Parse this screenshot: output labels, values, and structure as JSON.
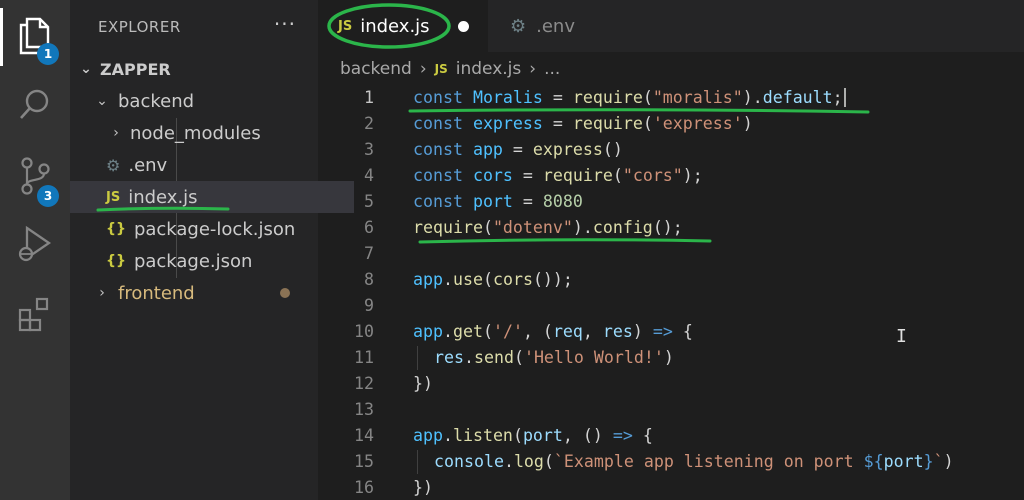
{
  "activity_bar": {
    "explorer_badge": "1",
    "scm_badge": "3",
    "icons": [
      "files-icon",
      "search-icon",
      "source-control-icon",
      "run-debug-icon",
      "extensions-icon"
    ]
  },
  "sidebar": {
    "title": "EXPLORER",
    "more": "···",
    "project": "ZAPPER",
    "items": [
      {
        "label": "backend",
        "type": "folder-open"
      },
      {
        "label": "node_modules",
        "type": "folder-closed"
      },
      {
        "label": ".env",
        "type": "settings-file"
      },
      {
        "label": "index.js",
        "type": "js-file",
        "badge": "JS"
      },
      {
        "label": "package-lock.json",
        "type": "json-file",
        "badge": "{}"
      },
      {
        "label": "package.json",
        "type": "json-file",
        "badge": "{}"
      },
      {
        "label": "frontend",
        "type": "folder-closed"
      }
    ]
  },
  "tabs": [
    {
      "label": "index.js",
      "badge": "JS",
      "active": true,
      "modified": true
    },
    {
      "label": ".env",
      "active": false
    }
  ],
  "breadcrumb": {
    "folder": "backend",
    "file_badge": "JS",
    "file": "index.js",
    "trail": "..."
  },
  "editor": {
    "current_line": 1,
    "lines": [
      {
        "n": "1"
      },
      {
        "n": "2"
      },
      {
        "n": "3"
      },
      {
        "n": "4"
      },
      {
        "n": "5"
      },
      {
        "n": "6"
      },
      {
        "n": "7"
      },
      {
        "n": "8"
      },
      {
        "n": "9"
      },
      {
        "n": "10"
      },
      {
        "n": "11"
      },
      {
        "n": "12"
      },
      {
        "n": "13"
      },
      {
        "n": "14"
      },
      {
        "n": "15"
      },
      {
        "n": "16"
      }
    ],
    "tokens": {
      "const": "const",
      "moralis_var": "Moralis",
      "eq": " = ",
      "require": "require",
      "moralis_str": "\"moralis\"",
      "default_prop": "default",
      "express_var": "express",
      "express_str": "'express'",
      "app_var": "app",
      "cors_var": "cors",
      "cors_str": "\"cors\"",
      "port_var": "port",
      "port_num": "8080",
      "dotenv_str": "\"dotenv\"",
      "config_fn": "config",
      "app": "app",
      "use_fn": "use",
      "get_fn": "get",
      "route_str": "'/'",
      "req": "req",
      "res": "res",
      "send_fn": "send",
      "hello_str": "'Hello World!'",
      "listen_fn": "listen",
      "console": "console",
      "log_fn": "log",
      "tpl_start": "`Example app listening on port ",
      "tpl_open": "${",
      "tpl_close": "}",
      "tpl_end": "`"
    }
  },
  "colors": {
    "annotation": "#2bb54a",
    "activity_bar": "#333333",
    "sidebar": "#252526",
    "editor": "#1e1e1e",
    "badge": "#1177bb"
  }
}
